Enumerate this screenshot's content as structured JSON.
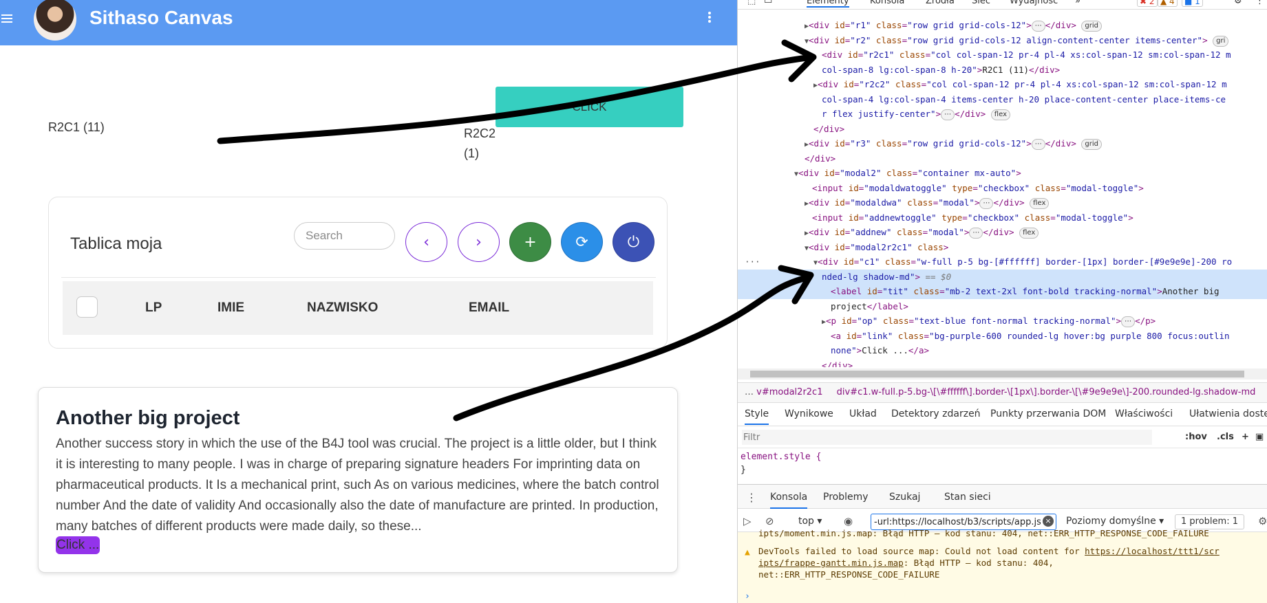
{
  "app": {
    "title": "Sithaso Canvas",
    "r2c1": "R2C1 (11)",
    "r2c2": "R2C2 (1)",
    "click_button": "CLICK",
    "table": {
      "title": "Tablica moja",
      "search_placeholder": "Search",
      "prev_icon": "‹",
      "next_icon": "›",
      "add_icon": "+",
      "refresh_icon": "⟳",
      "power_icon": "⏻",
      "columns": [
        "LP",
        "IMIE",
        "NAZWISKO",
        "EMAIL"
      ]
    },
    "project": {
      "title": "Another big project",
      "body": "Another success story in which the use of the B4J tool was crucial. The project is a little older, but I think it is interesting to many people. I was in charge of preparing signature headers For imprinting data on pharmaceutical products. It Is a mechanical print, such As on various medicines, where the batch control number And the date of validity And occasionally also the date of manufacture are printed. In production, many batches of different products were made daily, so these...",
      "link": "Click ..."
    }
  },
  "devtools": {
    "tabs": [
      "Elementy",
      "Konsola",
      "Źródła",
      "Sieć",
      "Wydajność",
      "»"
    ],
    "badges": {
      "errors": "2",
      "warnings": "4",
      "messages": "1"
    },
    "tree": {
      "r1": {
        "id": "r1",
        "class": "row grid grid-cols-12",
        "pill": "grid"
      },
      "r2": {
        "id": "r2",
        "class": "row grid grid-cols-12 align-content-center items-center",
        "pill": "gri"
      },
      "r2c1_line1": "col col-span-12 pr-4 pl-4 xs:col-span-12 sm:col-span-12 m",
      "r2c1_line2": "col-span-8 lg:col-span-8 h-20",
      "r2c1_text": "R2C1 (11)",
      "r2c2_line1": "col col-span-12 pr-4 pl-4 xs:col-span-12 sm:col-span-12 m",
      "r2c2_line2": "col-span-4 lg:col-span-4 items-center h-20 place-content-center place-items-ce",
      "r2c2_line3": "r flex justify-center",
      "r3": {
        "id": "r3",
        "class": "row grid grid-cols-12",
        "pill": "grid"
      },
      "modal2": {
        "id": "modal2",
        "class": "container mx-auto"
      },
      "modaldwatoggle": {
        "id": "modaldwatoggle",
        "type": "checkbox",
        "class": "modal-toggle"
      },
      "modaldwa": {
        "id": "modaldwa",
        "class": "modal",
        "pill": "flex"
      },
      "addnewtoggle": {
        "id": "addnewtoggle",
        "type": "checkbox",
        "class": "modal-toggle"
      },
      "addnew": {
        "id": "addnew",
        "class": "modal",
        "pill": "flex"
      },
      "modal2r2c1": {
        "id": "modal2r2c1",
        "class": ""
      },
      "c1_line1": "w-full p-5 bg-[#ffffff] border-[1px] border-[#9e9e9e]-200 ro",
      "c1_line2": "nded-lg shadow-md",
      "c1_eq": "== $0",
      "tit": {
        "id": "tit",
        "class": "mb-2 text-2xl font-bold tracking-normal",
        "text1": "Another big",
        "text2": "project"
      },
      "op": {
        "id": "op",
        "class": "text-blue font-normal tracking-normal"
      },
      "link_line1": "bg-purple-600 rounded-lg hover:bg purple 800 focus:outlin",
      "link_line2": "none",
      "link_text": "Click ..."
    },
    "breadcrumbs": [
      "v#modal2r2c1",
      "div#c1.w-full.p-5.bg-\\[\\#ffffff\\].border-\\[1px\\].border-\\[\\#9e9e9e\\]-200.rounded-lg.shadow-md"
    ],
    "style_tabs": [
      "Style",
      "Wynikowe",
      "Układ",
      "Detektory zdarzeń",
      "Punkty przerwania DOM",
      "Właściwości",
      "Ułatwienia dostęp"
    ],
    "filter_placeholder": "Filtr",
    "filter_tools": [
      ":hov",
      ".cls",
      "+"
    ],
    "element_style": "element.style {",
    "element_style_close": "}",
    "console_tabs": [
      "Konsola",
      "Problemy",
      "Szukaj",
      "Stan sieci"
    ],
    "context": "top",
    "console_filter": "-url:https://localhost/b3/scripts/app.js",
    "levels": "Poziomy domyślne",
    "problems": "1 problem: 1",
    "console": {
      "line0": "ipts/moment.min.js.map: Błąd HTTP – kod stanu: 404, net::ERR_HTTP_RESPONSE_CODE_FAILURE",
      "line1_pre": "DevTools failed to load source map: Could not load content for ",
      "line1_link": "https://localhost/ttt1/scr",
      "line2_link": "ipts/frappe-gantt.min.js.map",
      "line2_post": ": Błąd HTTP – kod stanu: 404,",
      "line3": "net::ERR_HTTP_RESPONSE_CODE_FAILURE"
    }
  }
}
